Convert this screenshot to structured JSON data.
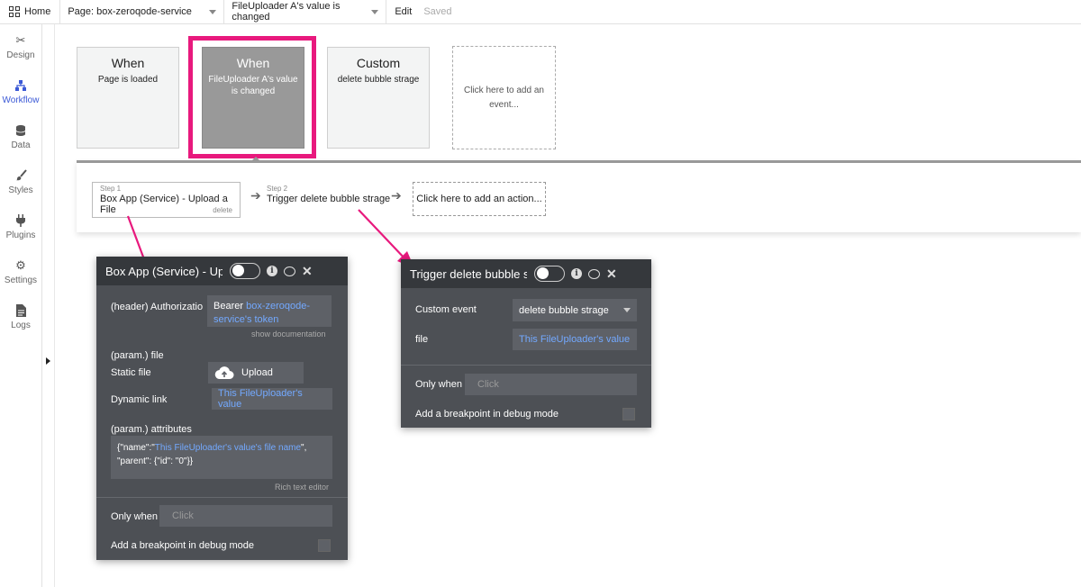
{
  "topbar": {
    "home_label": "Home",
    "page_select": "Page: box-zeroqode-service",
    "event_select": "FileUploader A's value is changed",
    "edit_label": "Edit",
    "saved_label": "Saved"
  },
  "sidebar": {
    "items": [
      {
        "label": "Design",
        "icon": "design-icon"
      },
      {
        "label": "Workflow",
        "icon": "workflow-icon"
      },
      {
        "label": "Data",
        "icon": "data-icon"
      },
      {
        "label": "Styles",
        "icon": "styles-icon"
      },
      {
        "label": "Plugins",
        "icon": "plugins-icon"
      },
      {
        "label": "Settings",
        "icon": "settings-icon"
      },
      {
        "label": "Logs",
        "icon": "logs-icon"
      }
    ],
    "active": "Workflow"
  },
  "events": [
    {
      "title": "When",
      "subtitle": "Page is loaded"
    },
    {
      "title": "When",
      "subtitle": "FileUploader A's value is changed"
    },
    {
      "title": "Custom",
      "subtitle": "delete bubble strage"
    }
  ],
  "add_event": "Click here to add an event...",
  "steps": {
    "step1_num": "Step 1",
    "step1_title": "Box App (Service) - Upload a File",
    "step1_delete": "delete",
    "step2_num": "Step 2",
    "step2_title": "Trigger delete bubble strage",
    "add_action": "Click here to add an action..."
  },
  "panel_upload": {
    "title": "Box App (Service) - Upload a File",
    "header_label": "(header) Authorizatio",
    "header_value_static": "Bearer ",
    "header_value_dynamic": "box-zeroqode-service's token",
    "show_docs": "show documentation",
    "param_file": "(param.) file",
    "static_file_label": "Static file",
    "upload_button": "Upload",
    "dynamic_link_label": "Dynamic link",
    "dynamic_link_value": "This FileUploader's value",
    "param_attributes": "(param.) attributes",
    "attr_line1_static": "{\"name\":\"",
    "attr_line1_dynamic": "This FileUploader's value's file name",
    "attr_line1_end": "\",",
    "attr_line2": "\"parent\": {\"id\": \"0\"}}",
    "rich_text": "Rich text editor",
    "only_when_label": "Only when",
    "only_when_placeholder": "Click",
    "breakpoint_label": "Add a breakpoint in debug mode"
  },
  "panel_trigger": {
    "title": "Trigger delete bubble strage",
    "custom_event_label": "Custom event",
    "custom_event_value": "delete bubble strage",
    "file_label": "file",
    "file_value": "This FileUploader's value",
    "only_when_label": "Only when",
    "only_when_placeholder": "Click",
    "breakpoint_label": "Add a breakpoint in debug mode"
  },
  "colors": {
    "accent": "#3b59d6",
    "highlight": "#e8197d",
    "panel_bg": "#4d5055",
    "dynamic_text": "#73a9ff"
  }
}
